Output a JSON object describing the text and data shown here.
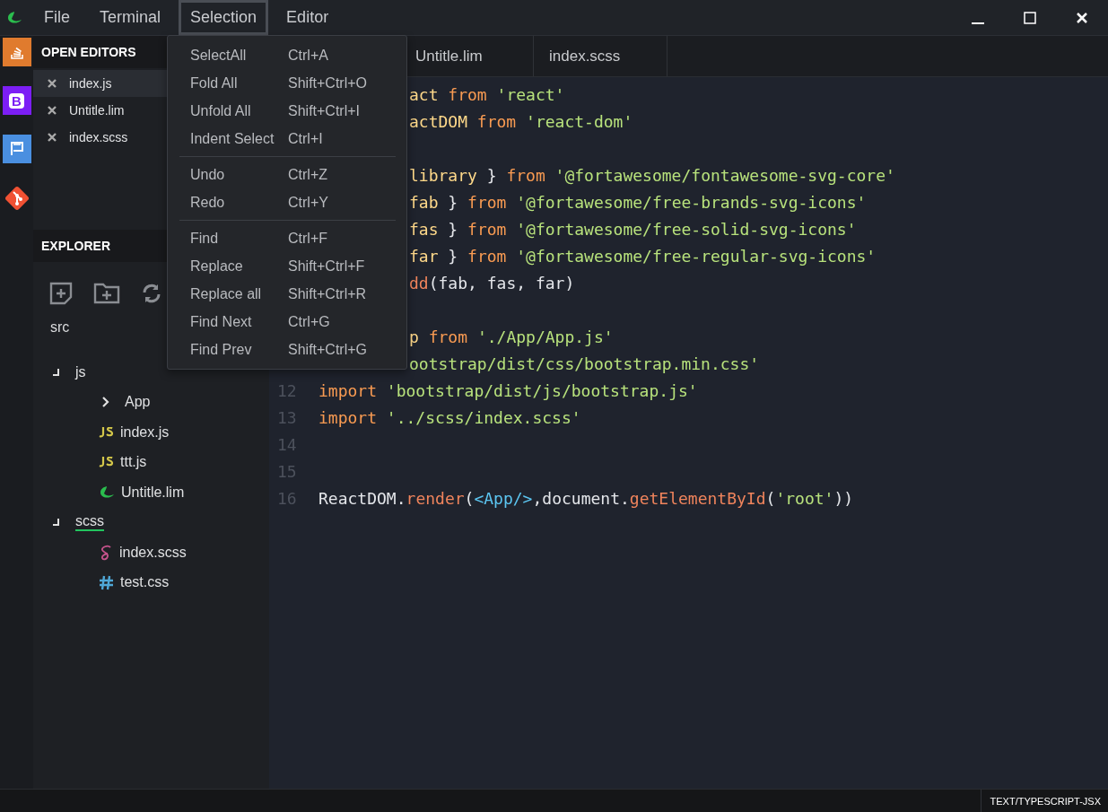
{
  "menubar": [
    {
      "label": "File",
      "selected": false
    },
    {
      "label": "Terminal",
      "selected": false
    },
    {
      "label": "Selection",
      "selected": true
    },
    {
      "label": "Editor",
      "selected": false
    }
  ],
  "activity_bar": [
    {
      "kind": "stack"
    },
    {
      "kind": "bootstrap",
      "glyph": "B"
    },
    {
      "kind": "flag"
    },
    {
      "kind": "git"
    }
  ],
  "open_editors": {
    "title": "OPEN EDITORS",
    "items": [
      {
        "name": "index.js",
        "selected": true
      },
      {
        "name": "Untitle.lim",
        "selected": false
      },
      {
        "name": "index.scss",
        "selected": false
      }
    ]
  },
  "explorer": {
    "title": "EXPLORER",
    "root": "src",
    "tree": [
      {
        "name": "js",
        "kind": "folder",
        "expanded": true,
        "selected": false,
        "children": [
          {
            "name": "App",
            "kind": "folder",
            "expanded": false,
            "selected": false
          },
          {
            "name": "index.js",
            "kind": "js",
            "selected": false
          },
          {
            "name": "ttt.js",
            "kind": "js",
            "selected": false
          },
          {
            "name": "Untitle.lim",
            "kind": "lim",
            "selected": false
          }
        ]
      },
      {
        "name": "scss",
        "kind": "folder",
        "expanded": true,
        "selected": true,
        "children": [
          {
            "name": "index.scss",
            "kind": "scss",
            "selected": false
          },
          {
            "name": "test.css",
            "kind": "css",
            "selected": false
          }
        ]
      }
    ]
  },
  "tabs": [
    {
      "label": "Untitle.lim",
      "selected": false
    },
    {
      "label": "index.scss",
      "selected": false
    }
  ],
  "code_lines": [
    {
      "kind": "code",
      "tokens": [
        {
          "kind": "id",
          "text": "act "
        },
        {
          "kind": "kw",
          "text": "from "
        },
        {
          "kind": "str",
          "text": "'react'"
        }
      ]
    },
    {
      "kind": "code",
      "tokens": [
        {
          "kind": "id",
          "text": "actDOM "
        },
        {
          "kind": "kw",
          "text": "from "
        },
        {
          "kind": "str",
          "text": "'react-dom'"
        }
      ]
    },
    {
      "kind": "blank"
    },
    {
      "kind": "code",
      "tokens": [
        {
          "kind": "id",
          "text": "library "
        },
        {
          "kind": "plain",
          "text": "} "
        },
        {
          "kind": "kw",
          "text": "from "
        },
        {
          "kind": "str",
          "text": "'@fortawesome/fontawesome-svg-core'"
        }
      ]
    },
    {
      "kind": "code",
      "tokens": [
        {
          "kind": "id",
          "text": "fab "
        },
        {
          "kind": "plain",
          "text": "} "
        },
        {
          "kind": "kw",
          "text": "from "
        },
        {
          "kind": "str",
          "text": "'@fortawesome/free-brands-svg-icons'"
        }
      ]
    },
    {
      "kind": "code",
      "tokens": [
        {
          "kind": "id",
          "text": "fas "
        },
        {
          "kind": "plain",
          "text": "} "
        },
        {
          "kind": "kw",
          "text": "from "
        },
        {
          "kind": "str",
          "text": "'@fortawesome/free-solid-svg-icons'"
        }
      ]
    },
    {
      "kind": "code",
      "tokens": [
        {
          "kind": "id",
          "text": "far "
        },
        {
          "kind": "plain",
          "text": "} "
        },
        {
          "kind": "kw",
          "text": "from "
        },
        {
          "kind": "str",
          "text": "'@fortawesome/free-regular-svg-icons'"
        }
      ]
    },
    {
      "kind": "code",
      "tokens": [
        {
          "kind": "fn",
          "text": "dd"
        },
        {
          "kind": "plain",
          "text": "(fab, fas, far)"
        }
      ]
    },
    {
      "kind": "blank"
    },
    {
      "kind": "code",
      "tokens": [
        {
          "kind": "id",
          "text": "p "
        },
        {
          "kind": "kw",
          "text": "from "
        },
        {
          "kind": "str",
          "text": "'./App/App.js'"
        }
      ]
    },
    {
      "kind": "code",
      "tokens": [
        {
          "kind": "str",
          "text": "ootstrap/dist/css/bootstrap.min.css'"
        }
      ]
    },
    {
      "kind": "code",
      "number": "12",
      "tokens": [
        {
          "kind": "kw",
          "text": "import "
        },
        {
          "kind": "str",
          "text": "'bootstrap/dist/js/bootstrap.js'"
        }
      ]
    },
    {
      "kind": "code",
      "number": "13",
      "tokens": [
        {
          "kind": "kw",
          "text": "import "
        },
        {
          "kind": "str",
          "text": "'../scss/index.scss'"
        }
      ]
    },
    {
      "kind": "blank",
      "number": "14"
    },
    {
      "kind": "blank",
      "number": "15"
    },
    {
      "kind": "code",
      "number": "16",
      "tokens": [
        {
          "kind": "plain",
          "text": "ReactDOM."
        },
        {
          "kind": "fn",
          "text": "render"
        },
        {
          "kind": "plain",
          "text": "("
        },
        {
          "kind": "tag",
          "text": "<App/>"
        },
        {
          "kind": "plain",
          "text": ",document."
        },
        {
          "kind": "fn",
          "text": "getElementById"
        },
        {
          "kind": "plain",
          "text": "("
        },
        {
          "kind": "str",
          "text": "'root'"
        },
        {
          "kind": "plain",
          "text": "))"
        }
      ]
    }
  ],
  "selection_menu": {
    "groups": [
      [
        {
          "label": "SelectAll",
          "shortcut": "Ctrl+A"
        },
        {
          "label": "Fold All",
          "shortcut": "Shift+Ctrl+O"
        },
        {
          "label": "Unfold All",
          "shortcut": "Shift+Ctrl+I"
        },
        {
          "label": "Indent Select",
          "shortcut": "Ctrl+I"
        }
      ],
      [
        {
          "label": "Undo",
          "shortcut": "Ctrl+Z"
        },
        {
          "label": "Redo",
          "shortcut": "Ctrl+Y"
        }
      ],
      [
        {
          "label": "Find",
          "shortcut": "Ctrl+F"
        },
        {
          "label": "Replace",
          "shortcut": "Shift+Ctrl+F"
        },
        {
          "label": "Replace all",
          "shortcut": "Shift+Ctrl+R"
        },
        {
          "label": "Find Next",
          "shortcut": "Ctrl+G"
        },
        {
          "label": "Find Prev",
          "shortcut": "Shift+Ctrl+G"
        }
      ]
    ]
  },
  "status_bar": {
    "language": "TEXT/TYPESCRIPT-JSX"
  }
}
